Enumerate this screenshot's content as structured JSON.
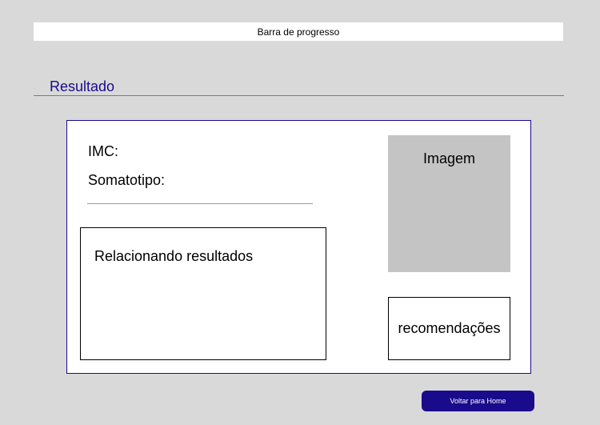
{
  "progress_bar": {
    "label": "Barra de progresso"
  },
  "section": {
    "title": "Resultado"
  },
  "result_card": {
    "imc_label": "IMC:",
    "somatotipo_label": "Somatotipo:",
    "relations_label": "Relacionando resultados",
    "image_label": "Imagem",
    "recommendations_label": "recomendações"
  },
  "actions": {
    "home_button_label": "Voltar para Home"
  },
  "colors": {
    "background": "#d9d9d9",
    "accent": "#1a0a8c",
    "image_placeholder": "#c4c4c4"
  }
}
